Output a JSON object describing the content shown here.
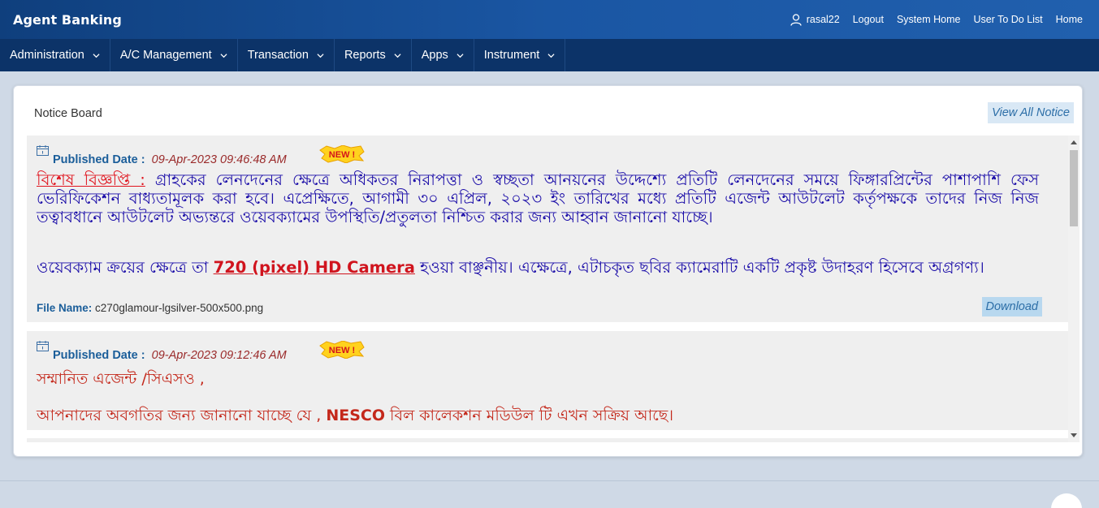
{
  "app": {
    "title": "Agent Banking"
  },
  "header": {
    "username": "rasal22",
    "links": [
      "Logout",
      "System Home",
      "User To Do List",
      "Home"
    ]
  },
  "menu": [
    {
      "label": "Administration"
    },
    {
      "label": "A/C Management"
    },
    {
      "label": "Transaction"
    },
    {
      "label": "Reports"
    },
    {
      "label": "Apps"
    },
    {
      "label": "Instrument"
    }
  ],
  "panel": {
    "title": "Notice Board",
    "view_all_label": "View All Notice"
  },
  "notices": [
    {
      "published_label": "Published Date :",
      "date": "09-Apr-2023 09:46:48 AM",
      "badge": "NEW !",
      "heading": "বিশেষ বিজ্ঞপ্তি :",
      "body1": "গ্রাহকের লেনদেনের ক্ষেত্রে অধিকতর নিরাপত্তা ও স্বচ্ছতা আনয়নের উদ্দেশ্যে প্রতিটি লেনদেনের সময়ে ফিঙ্গারপ্রিন্টের পাশাপাশি ফেস ভেরিফিকেশন বাধ্যতামূলক করা হবে। এপ্রেক্ষিতে, আগামী ৩০ এপ্রিল, ২০২৩ ইং তারিখের মধ্যে প্রতিটি এজেন্ট আউটলেট কর্তৃপক্ষকে তাদের নিজ নিজ তত্বাবধানে আউটলেট অভ্যন্তরে ওয়েবক্যামের উপস্থিতি/প্রতুলতা নিশ্চিত করার জন্য আহ্বান জানানো যাচ্ছে।",
      "body2_pre": "ওয়েবক্যাম ক্রয়ের ক্ষেত্রে তা ",
      "body2_highlight": "720 (pixel) HD Camera",
      "body2_post": " হওয়া বাঞ্ছনীয়। এক্ষেত্রে, এটাচকৃত ছবির ক্যামেরাটি একটি প্রকৃষ্ট উদাহরণ হিসেবে অগ্রগণ্য।",
      "file_label": "File Name:",
      "file_name": "c270glamour-lgsilver-500x500.png",
      "download_label": "Download"
    },
    {
      "published_label": "Published Date :",
      "date": "09-Apr-2023 09:12:46 AM",
      "badge": "NEW !",
      "line1": "সম্মানিত এজেন্ট /সিএসও ,",
      "line2_pre": "আপনাদের অবগতির জন্য জানানো যাচ্ছে যে , ",
      "line2_highlight": "NESCO",
      "line2_post": " বিল কালেকশন মডিউল টি এখন সক্রিয় আছে।"
    }
  ],
  "colors": {
    "header": "#1a56a3",
    "menubar": "#0c3368",
    "notice_text": "#1a0ca8",
    "alert_red": "#e0141e",
    "date_text": "#9a2a2a",
    "label_blue": "#1b5e9a"
  }
}
